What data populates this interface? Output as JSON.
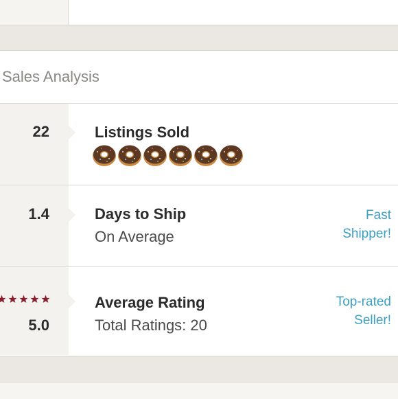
{
  "panel": {
    "title": "Sales Analysis"
  },
  "rows": [
    {
      "value": "22",
      "label": "Listings Sold",
      "icon": "donut-icon",
      "icon_count": 6
    },
    {
      "value": "1.4",
      "label": "Days to Ship",
      "sublabel": "On Average",
      "badge_line1": "Fast",
      "badge_line2": "Shipper!"
    },
    {
      "value": "5.0",
      "label": "Average Rating",
      "sublabel": "Total Ratings: 20",
      "stars": 5,
      "badge_line1": "Top-rated",
      "badge_line2": "Seller!"
    }
  ],
  "colors": {
    "accent_link": "#3c9fc0",
    "star": "#8c1f2e",
    "donut_frosting": "#5b3822",
    "donut_dough": "#c98a45"
  }
}
